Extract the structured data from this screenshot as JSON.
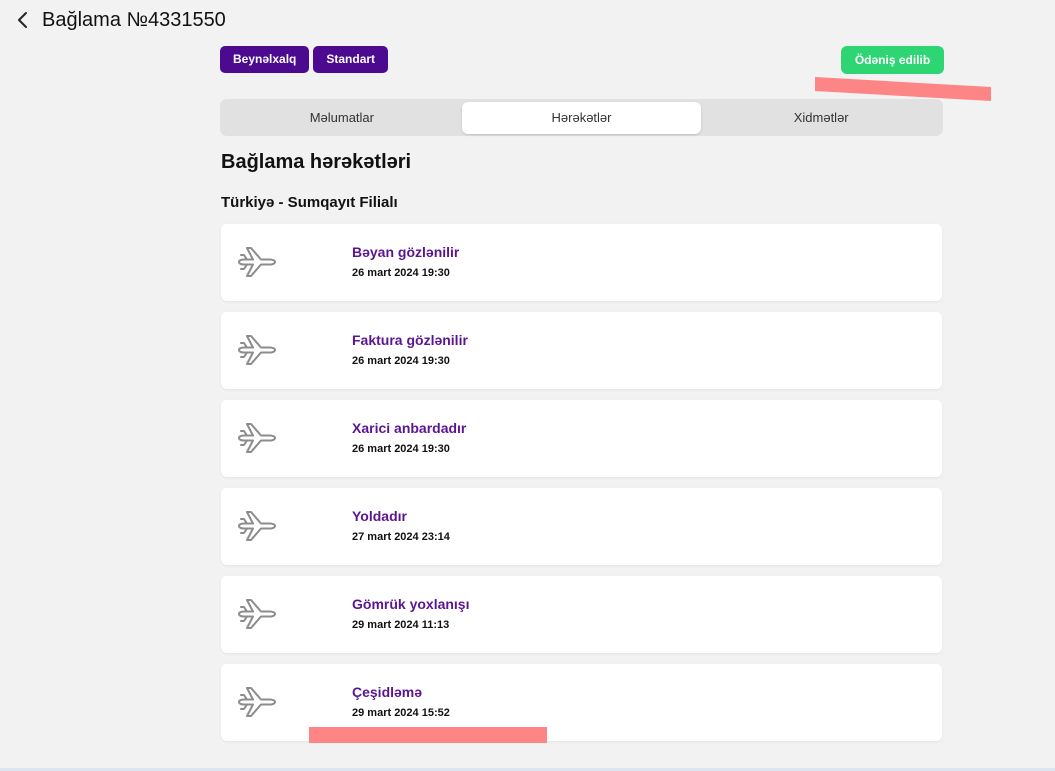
{
  "header": {
    "title": "Bağlama №4331550"
  },
  "badges": [
    {
      "label": "Beynəlxalq"
    },
    {
      "label": "Standart"
    }
  ],
  "payment_status": {
    "label": "Ödəniş edilib"
  },
  "tabs": [
    {
      "label": "Məlumatlar",
      "active": false
    },
    {
      "label": "Hərəkətlər",
      "active": true
    },
    {
      "label": "Xidmətlər",
      "active": false
    }
  ],
  "section": {
    "title": "Bağlama hərəkətləri",
    "branch": "Türkiyə - Sumqayıt Filialı"
  },
  "events": [
    {
      "status": "Bəyan gözlənilir",
      "date": "26 mart 2024 19:30"
    },
    {
      "status": "Faktura gözlənilir",
      "date": "26 mart 2024 19:30"
    },
    {
      "status": "Xarici anbardadır",
      "date": "26 mart 2024 19:30"
    },
    {
      "status": "Yoldadır",
      "date": "27 mart 2024 23:14"
    },
    {
      "status": "Gömrük yoxlanışı",
      "date": "29 mart 2024 11:13"
    },
    {
      "status": "Çeşidləmə",
      "date": "29 mart 2024 15:52"
    }
  ],
  "colors": {
    "brand_purple": "#4b0a8f",
    "status_text": "#5b1591",
    "paid_green": "#2ed573",
    "redaction": "#fd8585"
  },
  "icons": {
    "back": "chevron-left-icon",
    "event": "airplane-icon"
  }
}
